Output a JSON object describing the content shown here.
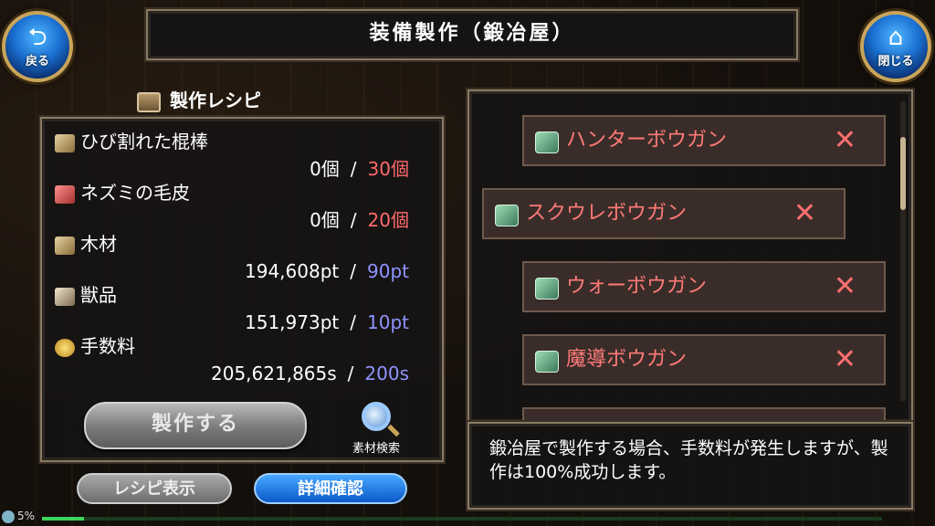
{
  "header": {
    "title": "装備製作（鍛冶屋）"
  },
  "nav": {
    "back": {
      "label": "戻る",
      "icon": "back-arrow-icon"
    },
    "close": {
      "label": "閉じる",
      "icon": "home-icon"
    }
  },
  "recipe": {
    "header": "製作レシピ",
    "materials": [
      {
        "name": "ひび割れた棍棒",
        "have": "0個",
        "need": "30個",
        "need_color": "red",
        "icon": "club-icon"
      },
      {
        "name": "ネズミの毛皮",
        "have": "0個",
        "need": "20個",
        "need_color": "red",
        "icon": "fur-icon"
      },
      {
        "name": "木材",
        "have": "194,608pt",
        "need": "90pt",
        "need_color": "blue",
        "icon": "wood-icon"
      },
      {
        "name": "獣品",
        "have": "151,973pt",
        "need": "10pt",
        "need_color": "blue",
        "icon": "fang-icon"
      },
      {
        "name": "手数料",
        "have": "205,621,865s",
        "need": "200s",
        "need_color": "blue",
        "icon": "coin-icon"
      }
    ],
    "separator": "/",
    "craft_label": "製作する",
    "search_label": "素材検索"
  },
  "buttons": {
    "recipe_view": "レシピ表示",
    "detail": "詳細確認"
  },
  "equipment_list": [
    {
      "name": "ハンターボウガン",
      "mark": "✕"
    },
    {
      "name": "スクウレボウガン",
      "mark": "✕"
    },
    {
      "name": "ウォーボウガン",
      "mark": "✕"
    },
    {
      "name": "魔導ボウガン",
      "mark": "✕"
    }
  ],
  "description": "鍛冶屋で製作する場合、手数料が発生しますが、製作は100%成功します。",
  "status": {
    "percent": "5%",
    "progress": 0.05
  },
  "colors": {
    "red": "#ff6b6b",
    "blue": "#8f94ff",
    "item_text": "#ff7a78",
    "accent_gold": "#c9a55a"
  }
}
